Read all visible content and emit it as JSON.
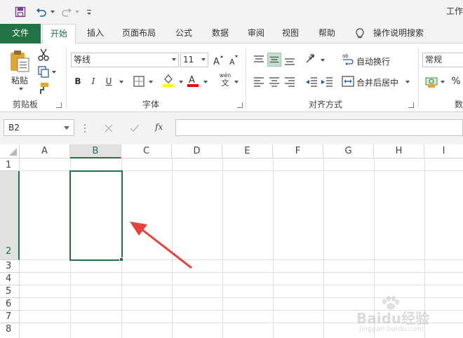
{
  "window": {
    "title": "工作"
  },
  "tabs": [
    {
      "label": "文件"
    },
    {
      "label": "开始"
    },
    {
      "label": "插入"
    },
    {
      "label": "页面布局"
    },
    {
      "label": "公式"
    },
    {
      "label": "数据"
    },
    {
      "label": "审阅"
    },
    {
      "label": "视图"
    },
    {
      "label": "帮助"
    },
    {
      "label": "操作说明搜索"
    }
  ],
  "ribbon": {
    "clipboard": {
      "paste_label": "粘贴",
      "group_label": "剪贴板"
    },
    "font": {
      "font_name": "等线",
      "font_size": "11",
      "bold": "B",
      "italic": "I",
      "underline": "U",
      "fill_color": "#ffff00",
      "font_color": "#ff0000",
      "wen_top": "wén",
      "wen_bottom": "文",
      "group_label": "字体"
    },
    "alignment": {
      "wrap_label": "自动换行",
      "merge_label": "合并后居中",
      "group_label": "对齐方式"
    },
    "number": {
      "format": "常规",
      "percent": "%",
      "group_label": "数"
    }
  },
  "formula_bar": {
    "name_box": "B2",
    "value": "",
    "fx": "fx"
  },
  "sheet": {
    "columns": [
      "A",
      "B",
      "C",
      "D",
      "E",
      "F",
      "G",
      "H",
      "I"
    ],
    "rows": [
      "1",
      "2",
      "3",
      "4",
      "5",
      "6",
      "7",
      "8"
    ],
    "selected_cell": "B2",
    "accent": "#217346"
  },
  "annotation": {
    "arrow_color": "#e8413c"
  },
  "watermark": {
    "brand": "Baidu经验",
    "url": "jingyan.baidu.com"
  }
}
